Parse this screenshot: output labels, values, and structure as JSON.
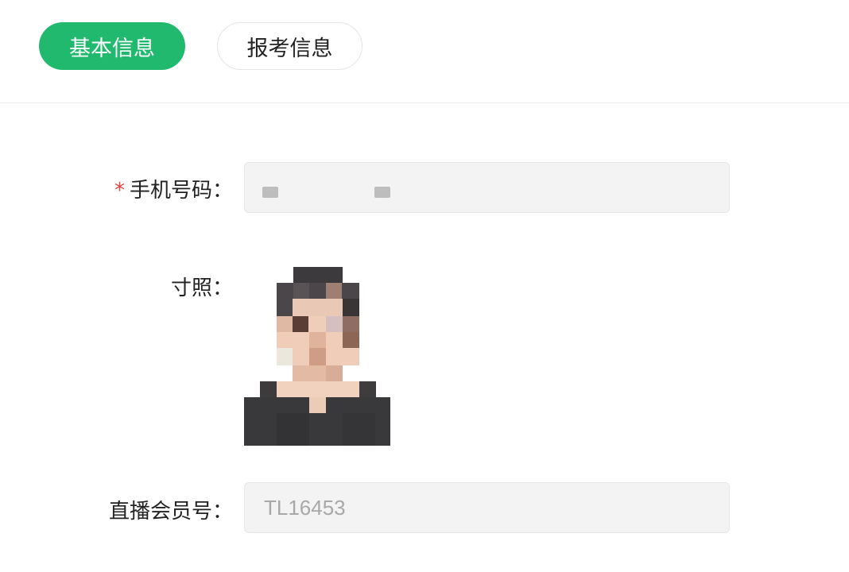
{
  "tabs": {
    "basic_info": "基本信息",
    "exam_info": "报考信息"
  },
  "form": {
    "phone": {
      "required_mark": "*",
      "label": "手机号码：",
      "value": ""
    },
    "photo": {
      "label": "寸照：",
      "image": "pixelated-portrait"
    },
    "member_id": {
      "label": "直播会员号：",
      "value": "TL16453"
    }
  },
  "colors": {
    "accent": "#21b96e",
    "required": "#e8413b",
    "field_bg": "#f3f3f3"
  }
}
